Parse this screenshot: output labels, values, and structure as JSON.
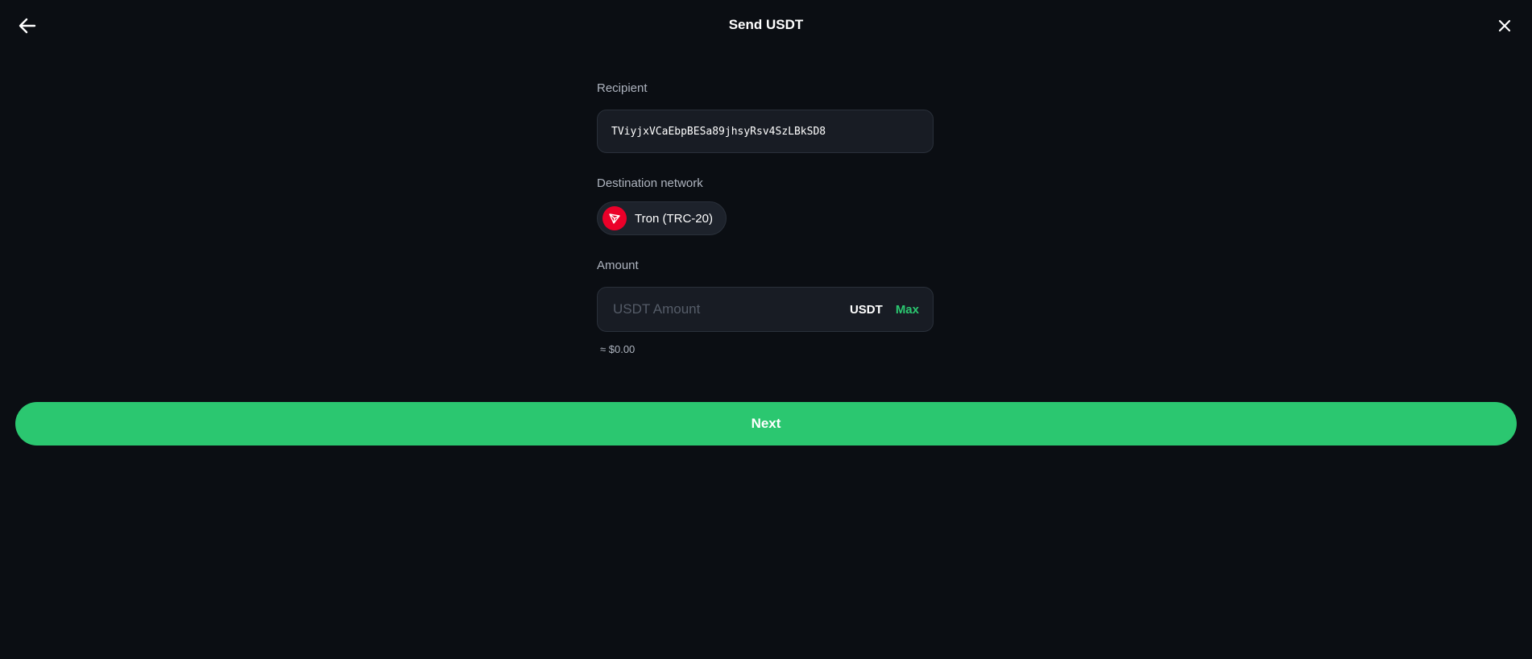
{
  "header": {
    "title": "Send USDT",
    "back_icon": "arrow-left-icon",
    "close_icon": "close-icon"
  },
  "recipient": {
    "label": "Recipient",
    "value": "TViyjxVCaEbpBESa89jhsyRsv4SzLBkSD8"
  },
  "network": {
    "label": "Destination network",
    "name": "Tron (TRC-20)",
    "icon": "tron-icon",
    "icon_color": "#eb0029"
  },
  "amount": {
    "label": "Amount",
    "placeholder": "USDT Amount",
    "value": "",
    "unit": "USDT",
    "max_label": "Max",
    "fiat_estimate": "≈ $0.00"
  },
  "actions": {
    "next_label": "Next"
  },
  "colors": {
    "background": "#0b0e13",
    "accent": "#2bc770",
    "field_bg": "#181c24"
  }
}
